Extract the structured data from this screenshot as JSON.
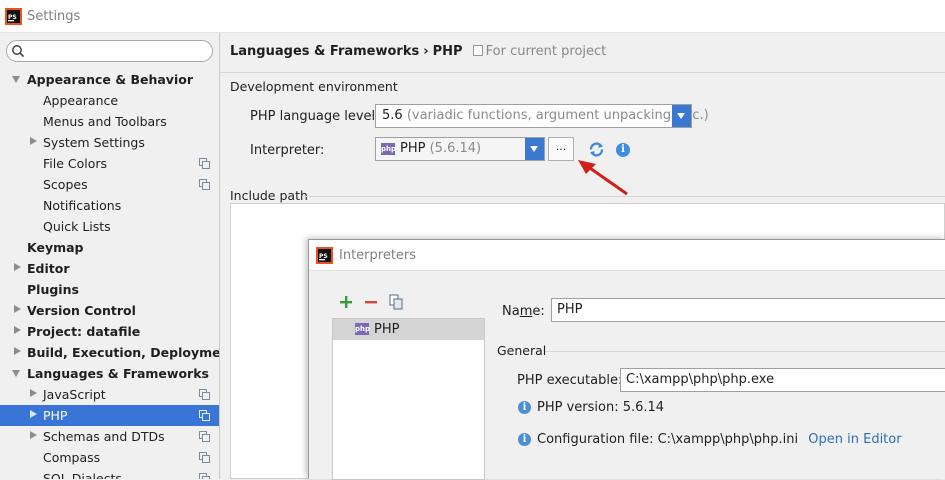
{
  "window": {
    "title": "Settings"
  },
  "sidebar": {
    "search_placeholder": "",
    "items": [
      {
        "label": "Appearance & Behavior",
        "level": 0,
        "bold": true,
        "arrow": "open",
        "copy": false,
        "selected": false
      },
      {
        "label": "Appearance",
        "level": 1,
        "bold": false,
        "arrow": "none",
        "copy": false,
        "selected": false
      },
      {
        "label": "Menus and Toolbars",
        "level": 1,
        "bold": false,
        "arrow": "none",
        "copy": false,
        "selected": false
      },
      {
        "label": "System Settings",
        "level": 1,
        "bold": false,
        "arrow": "closed",
        "copy": false,
        "selected": false
      },
      {
        "label": "File Colors",
        "level": 1,
        "bold": false,
        "arrow": "none",
        "copy": true,
        "selected": false
      },
      {
        "label": "Scopes",
        "level": 1,
        "bold": false,
        "arrow": "none",
        "copy": true,
        "selected": false
      },
      {
        "label": "Notifications",
        "level": 1,
        "bold": false,
        "arrow": "none",
        "copy": false,
        "selected": false
      },
      {
        "label": "Quick Lists",
        "level": 1,
        "bold": false,
        "arrow": "none",
        "copy": false,
        "selected": false
      },
      {
        "label": "Keymap",
        "level": 0,
        "bold": true,
        "arrow": "none",
        "copy": false,
        "selected": false
      },
      {
        "label": "Editor",
        "level": 0,
        "bold": true,
        "arrow": "closed",
        "copy": false,
        "selected": false
      },
      {
        "label": "Plugins",
        "level": 0,
        "bold": true,
        "arrow": "none",
        "copy": false,
        "selected": false
      },
      {
        "label": "Version Control",
        "level": 0,
        "bold": true,
        "arrow": "closed",
        "copy": false,
        "selected": false
      },
      {
        "label": "Project: datafile",
        "level": 0,
        "bold": true,
        "arrow": "closed",
        "copy": false,
        "selected": false
      },
      {
        "label": "Build, Execution, Deployment",
        "level": 0,
        "bold": true,
        "arrow": "closed",
        "copy": false,
        "selected": false
      },
      {
        "label": "Languages & Frameworks",
        "level": 0,
        "bold": true,
        "arrow": "open",
        "copy": false,
        "selected": false
      },
      {
        "label": "JavaScript",
        "level": 1,
        "bold": false,
        "arrow": "closed",
        "copy": true,
        "selected": false
      },
      {
        "label": "PHP",
        "level": 1,
        "bold": false,
        "arrow": "closed",
        "copy": true,
        "selected": true
      },
      {
        "label": "Schemas and DTDs",
        "level": 1,
        "bold": false,
        "arrow": "closed",
        "copy": true,
        "selected": false
      },
      {
        "label": "Compass",
        "level": 1,
        "bold": false,
        "arrow": "none",
        "copy": true,
        "selected": false
      },
      {
        "label": "SQL Dialects",
        "level": 1,
        "bold": false,
        "arrow": "none",
        "copy": true,
        "selected": false
      }
    ]
  },
  "main": {
    "breadcrumb": {
      "parent": "Languages & Frameworks",
      "separator": "›",
      "current": "PHP",
      "scope": "For current project"
    },
    "dev_env_label": "Development environment",
    "php_level": {
      "label": "PHP language level:",
      "value": "5.6",
      "hint": "(variadic functions, argument unpacking, etc.)"
    },
    "interpreter": {
      "label": "Interpreter:",
      "value": "PHP",
      "hint": "(5.6.14)",
      "more_button": "..."
    },
    "include_path_label": "Include path"
  },
  "dialog": {
    "title": "Interpreters",
    "list": [
      "PHP"
    ],
    "name": {
      "label_before": "Na",
      "label_underlined": "m",
      "label_after": "e:",
      "value": "PHP"
    },
    "general_label": "General",
    "php_executable": {
      "label": "PHP executable:",
      "value": "C:\\xampp\\php\\php.exe"
    },
    "php_version": "PHP version: 5.6.14",
    "config_file": "Configuration file: C:\\xampp\\php\\php.ini",
    "open_in_editor": "Open in Editor"
  },
  "colors": {
    "accent": "#3875d7",
    "dropdown": "#3b78cf",
    "link": "#2f6fb3",
    "arrow": "#d0201a"
  }
}
